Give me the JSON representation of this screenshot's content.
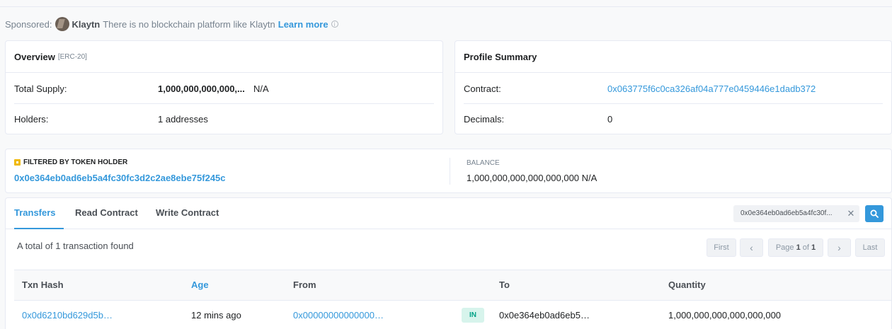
{
  "sponsor": {
    "prefix": "Sponsored:",
    "brand": "Klaytn",
    "text": "There is no blockchain platform like Klaytn",
    "link": "Learn more",
    "info_icon": "info-icon"
  },
  "overview": {
    "title": "Overview",
    "tag": "[ERC-20]",
    "total_supply_label": "Total Supply:",
    "total_supply_value": "1,000,000,000,000,...",
    "total_supply_unit": "N/A",
    "holders_label": "Holders:",
    "holders_value": "1 addresses"
  },
  "profile": {
    "title": "Profile Summary",
    "contract_label": "Contract:",
    "contract_value": "0x063775f6c0ca326af04a777e0459446e1dadb372",
    "decimals_label": "Decimals:",
    "decimals_value": "0"
  },
  "filter": {
    "label": "FILTERED BY TOKEN HOLDER",
    "address": "0x0e364eb0ad6eb5a4fc30fc3d2c2ae8ebe75f245c",
    "balance_label": "BALANCE",
    "balance_value": "1,000,000,000,000,000,000 N/A"
  },
  "tabs": [
    "Transfers",
    "Read Contract",
    "Write Contract"
  ],
  "search": {
    "value": "0x0e364eb0ad6eb5a4fc30f...",
    "clear": "✕"
  },
  "summary": "A total of 1 transaction found",
  "pager": {
    "first": "First",
    "prev": "‹",
    "page_prefix": "Page",
    "page_current": "1",
    "page_of": "of",
    "page_total": "1",
    "next": "›",
    "last": "Last"
  },
  "table": {
    "headers": [
      "Txn Hash",
      "Age",
      "From",
      "To",
      "Quantity"
    ],
    "rows": [
      {
        "hash": "0x0d6210bd629d5b…",
        "age": "12 mins ago",
        "from": "0x00000000000000…",
        "direction": "IN",
        "to": "0x0e364eb0ad6eb5…",
        "quantity": "1,000,000,000,000,000,000"
      }
    ]
  },
  "colors": {
    "accent": "#3498db",
    "in_badge_bg": "#d7f4ec",
    "in_badge_text": "#00a186"
  }
}
